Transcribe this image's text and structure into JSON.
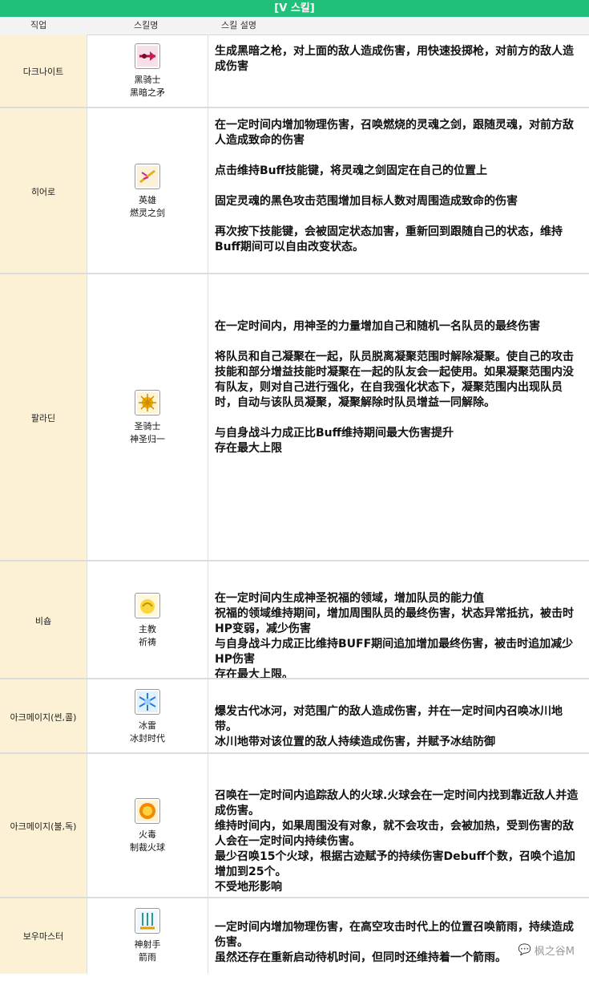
{
  "header": {
    "title": "[V 스킬]",
    "col_job": "직업",
    "col_skill": "스킬명",
    "col_desc": "스킬 설명"
  },
  "rows": [
    {
      "job": "다크나이트",
      "skill_line1": "黑骑士",
      "skill_line2": "黑暗之矛",
      "icon": "dark-spear-icon",
      "desc": [
        "生成黑暗之枪，对上面的敌人造成伤害，用快速投掷枪，对前方的敌人造成伤害"
      ]
    },
    {
      "job": "히어로",
      "skill_line1": "英雄",
      "skill_line2": "燃灵之剑",
      "icon": "burning-sword-icon",
      "desc": [
        "在一定时间内增加物理伤害，召唤燃烧的灵魂之剑，跟随灵魂，对前方敌人造成致命的伤害",
        "点击维持Buff技能键，将灵魂之剑固定在自己的位置上",
        "固定灵魂的黑色攻击范围增加目标人数对周围造成致命的伤害",
        "再次按下技能键，会被固定状态加害，重新回到跟随自己的状态，维持Buff期间可以自由改变状态。"
      ]
    },
    {
      "job": "팔라딘",
      "skill_line1": "圣骑士",
      "skill_line2": "神圣归一",
      "icon": "holy-unity-icon",
      "desc": [
        "在一定时间内，用神圣的力量增加自己和随机一名队员的最终伤害",
        "将队员和自己凝聚在一起，队员脱离凝聚范围时解除凝聚。使自己的攻击技能和部分增益技能时凝聚在一起的队友会一起使用。如果凝聚范围内没有队友，则对自己进行强化，在自我强化状态下，凝聚范围内出现队员时，自动与该队员凝聚，凝聚解除时队员增益一同解除。",
        "与自身战斗力成正比Buff维持期间最大伤害提升\n存在最大上限"
      ]
    },
    {
      "job": "비숍",
      "skill_line1": "主教",
      "skill_line2": "祈祷",
      "icon": "prayer-icon",
      "desc": [
        "在一定时间内生成神圣祝福的领域，增加队员的能力值\n祝福的领域维持期间，增加周围队员的最终伤害，状态异常抵抗，被击时HP变弱，减少伤害\n与自身战斗力成正比维持BUFF期间追加增加最终伤害，被击时追加减少HP伤害\n存在最大上限。"
      ]
    },
    {
      "job": "아크메이지(썬,콜)",
      "skill_line1": "冰雷",
      "skill_line2": "冰封时代",
      "icon": "ice-age-icon",
      "desc": [
        "爆发古代冰河，对范围广的敌人造成伤害，并在一定时间内召唤冰川地带。\n冰川地带对该位置的敌人持续造成伤害，并赋予冰结防御"
      ]
    },
    {
      "job": "아크메이지(불,독)",
      "skill_line1": "火毒",
      "skill_line2": "制裁火球",
      "icon": "fireball-icon",
      "desc": [
        "召唤在一定时间内追踪敌人的火球.火球会在一定时间内找到靠近敌人并造成伤害。\n维持时间内，如果周围没有对象，就不会攻击，会被加热，受到伤害的敌人会在一定时间内持续伤害。\n最少召唤15个火球，根据古迹赋予的持续伤害Debuff个数，召唤个追加增加到25个。\n不受地形影响"
      ]
    },
    {
      "job": "보우마스터",
      "skill_line1": "神射手",
      "skill_line2": "箭雨",
      "icon": "arrow-rain-icon",
      "desc": [
        "一定时间内增加物理伤害，在高空攻击时代上的位置召唤箭雨，持续造成伤害。\n虽然还存在重新启动待机时间，但同时还维持着一个箭雨。"
      ]
    }
  ],
  "watermark": "枫之谷M"
}
